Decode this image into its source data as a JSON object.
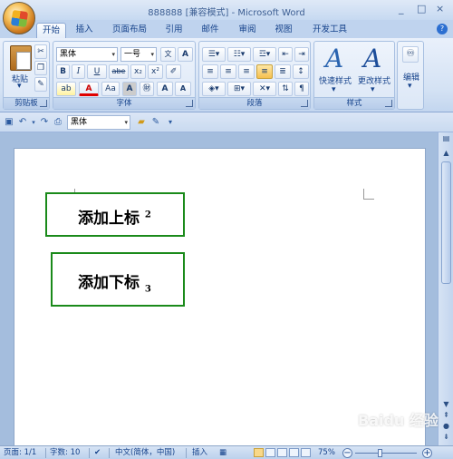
{
  "title": "888888 [兼容模式] - Microsoft Word",
  "window_controls": [
    "_",
    "□",
    "×"
  ],
  "tabs": [
    {
      "label": "开始",
      "active": true
    },
    {
      "label": "插入"
    },
    {
      "label": "页面布局"
    },
    {
      "label": "引用"
    },
    {
      "label": "邮件"
    },
    {
      "label": "审阅"
    },
    {
      "label": "视图"
    },
    {
      "label": "开发工具"
    }
  ],
  "ribbon": {
    "clipboard": {
      "label": "剪贴板",
      "paste": "粘贴"
    },
    "font": {
      "label": "字体",
      "font_name": "黑体",
      "font_size": "一号",
      "bold": "B",
      "italic": "I",
      "underline": "U",
      "strike": "abe",
      "subscript": "x₂",
      "superscript": "x²",
      "grow": "A",
      "shrink": "A",
      "case": "Aa",
      "clear": "A"
    },
    "paragraph": {
      "label": "段落"
    },
    "styles": {
      "label": "样式",
      "quick_styles": "快速样式",
      "change_styles": "更改样式"
    },
    "editing": {
      "label": "编辑"
    }
  },
  "qat": {
    "font": "黑体"
  },
  "document": {
    "box1": {
      "text": "添加上标",
      "mark": "2"
    },
    "box2": {
      "text": "添加下标",
      "mark": "3"
    }
  },
  "statusbar": {
    "page": "页面: 1/1",
    "words": "字数: 10",
    "language": "中文(简体，中国)",
    "mode": "插入",
    "zoom": "75%"
  },
  "watermark": "Baidu 经验",
  "colors": {
    "box_border": "#1a8a1a",
    "accent": "#15428b"
  }
}
